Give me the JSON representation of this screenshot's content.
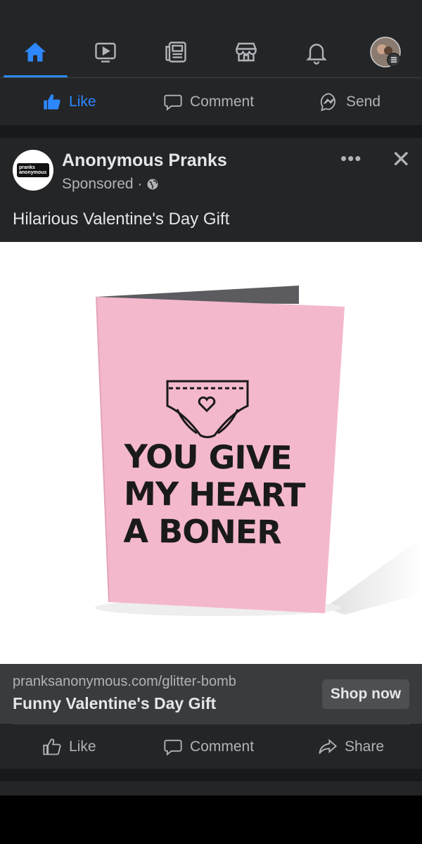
{
  "nav": {
    "icons": [
      "home-icon",
      "watch-icon",
      "news-icon",
      "marketplace-icon",
      "notifications-icon",
      "profile-menu-icon"
    ],
    "active_color": "#2d88ff",
    "icon_color": "#b0b3b8"
  },
  "prev_post_actions": {
    "like": "Like",
    "comment": "Comment",
    "send": "Send"
  },
  "post": {
    "page_name": "Anonymous Pranks",
    "avatar_logo": [
      "pranks",
      "anonymous"
    ],
    "sponsored": "Sponsored ·",
    "text": "Hilarious Valentine's Day Gift",
    "image": {
      "card_text_lines": [
        "YOU GIVE",
        "MY HEART",
        "A BONER"
      ],
      "card_color": "#f4b8cd"
    },
    "link": {
      "url": "pranksanonymous.com/glitter-bomb",
      "title": "Funny Valentine's Day Gift",
      "cta": "Shop now"
    },
    "actions": {
      "like": "Like",
      "comment": "Comment",
      "share": "Share"
    }
  },
  "colors": {
    "background": "#18191a",
    "card": "#242526",
    "link_bar": "#3a3b3c",
    "text_primary": "#e4e6eb",
    "text_secondary": "#b0b3b8",
    "accent": "#2d88ff"
  }
}
